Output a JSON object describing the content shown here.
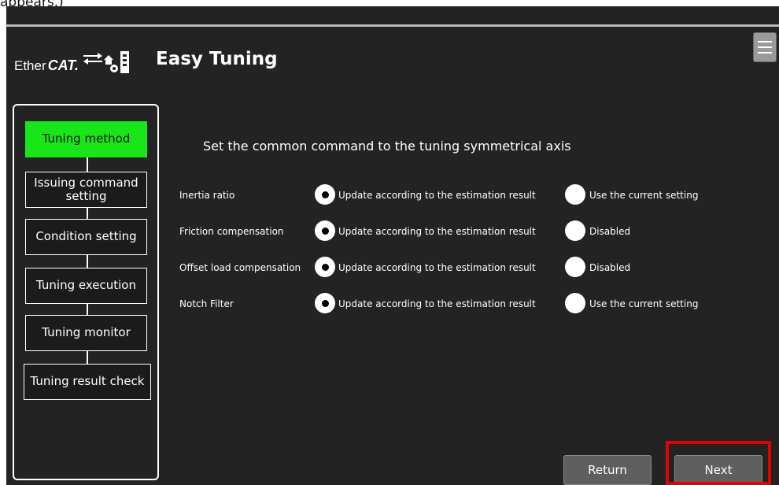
{
  "top_caption": "appears.)",
  "header": {
    "logo_ether": "Ether",
    "logo_cat": "CAT.",
    "title": "Easy Tuning",
    "menu_icon": "hamburger-menu-icon"
  },
  "steps": [
    {
      "label": "Tuning method",
      "active": true
    },
    {
      "label": "Issuing command setting",
      "active": false
    },
    {
      "label": "Condition setting",
      "active": false
    },
    {
      "label": "Tuning execution",
      "active": false
    },
    {
      "label": "Tuning monitor",
      "active": false
    },
    {
      "label": "Tuning result check",
      "active": false
    }
  ],
  "main": {
    "instruction": "Set the common command to the tuning symmetrical axis",
    "settings": [
      {
        "label": "Inertia ratio",
        "option1": "Update according to the estimation result",
        "option2": "Use the current setting",
        "selected": 1
      },
      {
        "label": "Friction compensation",
        "option1": "Update according to the estimation result",
        "option2": "Disabled",
        "selected": 1
      },
      {
        "label": "Offset load compensation",
        "option1": "Update according to the estimation result",
        "option2": "Disabled",
        "selected": 1
      },
      {
        "label": "Notch Filter",
        "option1": "Update according to the estimation result",
        "option2": "Use the current setting",
        "selected": 1
      }
    ]
  },
  "footer": {
    "return_label": "Return",
    "next_label": "Next"
  },
  "colors": {
    "background": "#232323",
    "active_step": "#18e618",
    "highlight": "#e60000"
  }
}
